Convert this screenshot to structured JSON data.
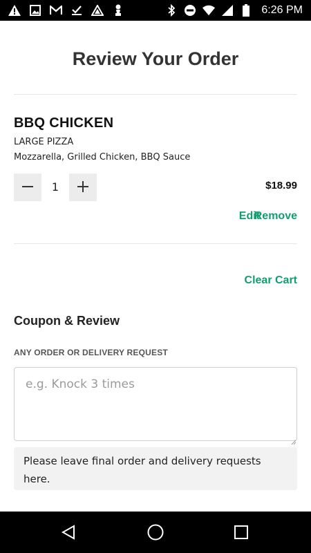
{
  "status_bar": {
    "time": "6:26 PM",
    "left_icons": [
      "warning-icon",
      "image-icon",
      "gmail-icon",
      "checkmark-download-icon",
      "triangle-app-icon",
      "chess-pawn-icon"
    ],
    "right_icons": [
      "bluetooth-icon",
      "do-not-disturb-icon",
      "wifi-icon",
      "signal-icon",
      "battery-icon"
    ]
  },
  "page": {
    "title": "Review Your Order"
  },
  "cart_item": {
    "name": "BBQ CHICKEN",
    "size": "LARGE PIZZA",
    "toppings": "Mozzarella, Grilled Chicken, BBQ Sauce",
    "quantity": "1",
    "price": "$18.99",
    "edit_label": "Edit",
    "remove_label": "Remove"
  },
  "cart_actions": {
    "clear_label": "Clear Cart"
  },
  "coupon_section": {
    "title": "Coupon & Review",
    "field_label": "ANY ORDER OR DELIVERY REQUEST",
    "placeholder": "e.g. Knock 3 times",
    "value": "",
    "note": "Please leave final order and delivery requests here."
  },
  "nav_bar": {
    "buttons": [
      "back-icon",
      "home-icon",
      "recent-apps-icon"
    ]
  },
  "colors": {
    "accent": "#0f9f6e",
    "qty_button_bg": "#ececec",
    "note_bg": "#f2f2f2"
  }
}
